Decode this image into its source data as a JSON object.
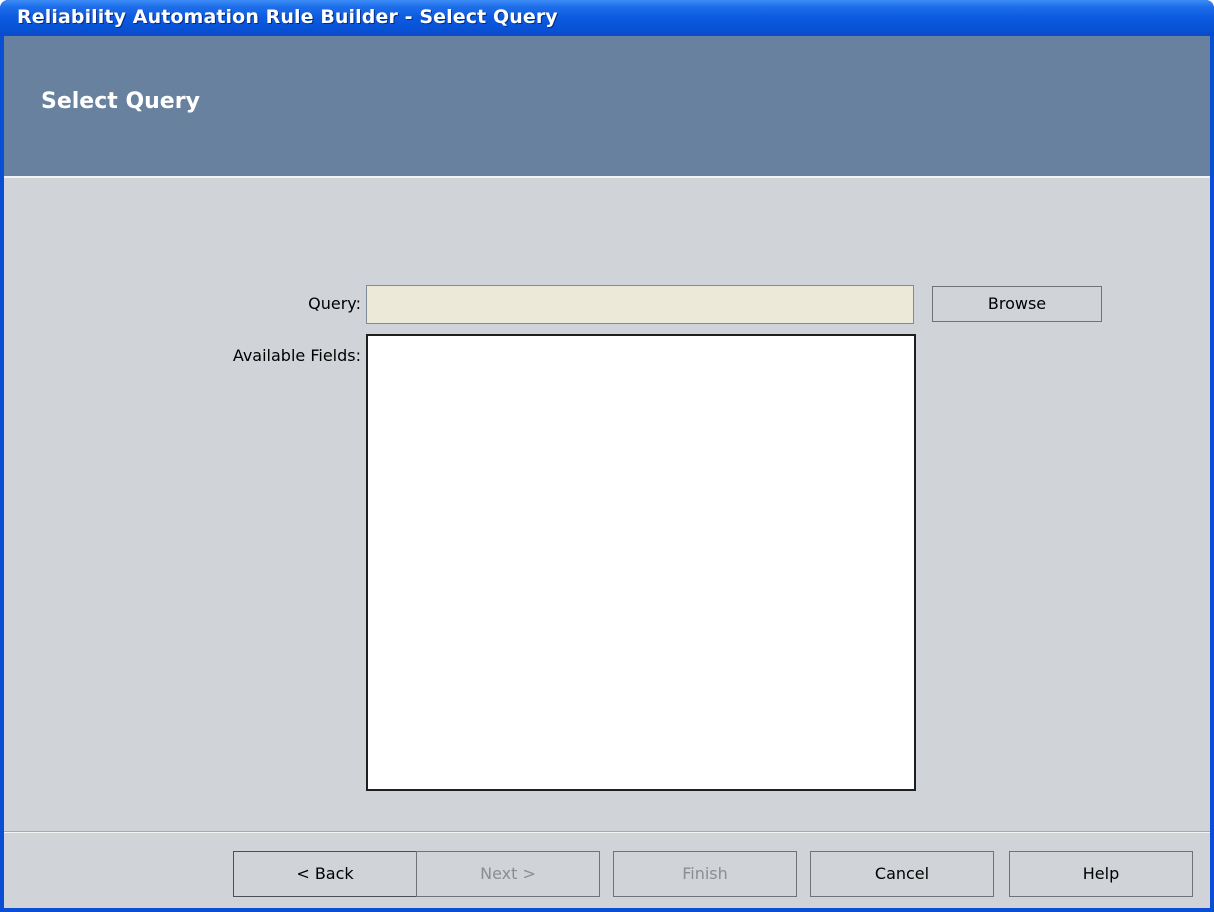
{
  "window": {
    "title": "Reliability Automation Rule Builder - Select Query"
  },
  "header": {
    "title": "Select Query"
  },
  "form": {
    "query_label": "Query:",
    "query_value": "",
    "browse_label": "Browse",
    "available_fields_label": "Available Fields:",
    "available_fields": []
  },
  "footer": {
    "back_label": "< Back",
    "next_label": "Next >",
    "finish_label": "Finish",
    "cancel_label": "Cancel",
    "help_label": "Help"
  },
  "colors": {
    "titlebar": "#0b5ae0",
    "header_band": "#67819f",
    "dialog_background": "#d0d3d8",
    "query_field_background": "#ece9d8"
  }
}
